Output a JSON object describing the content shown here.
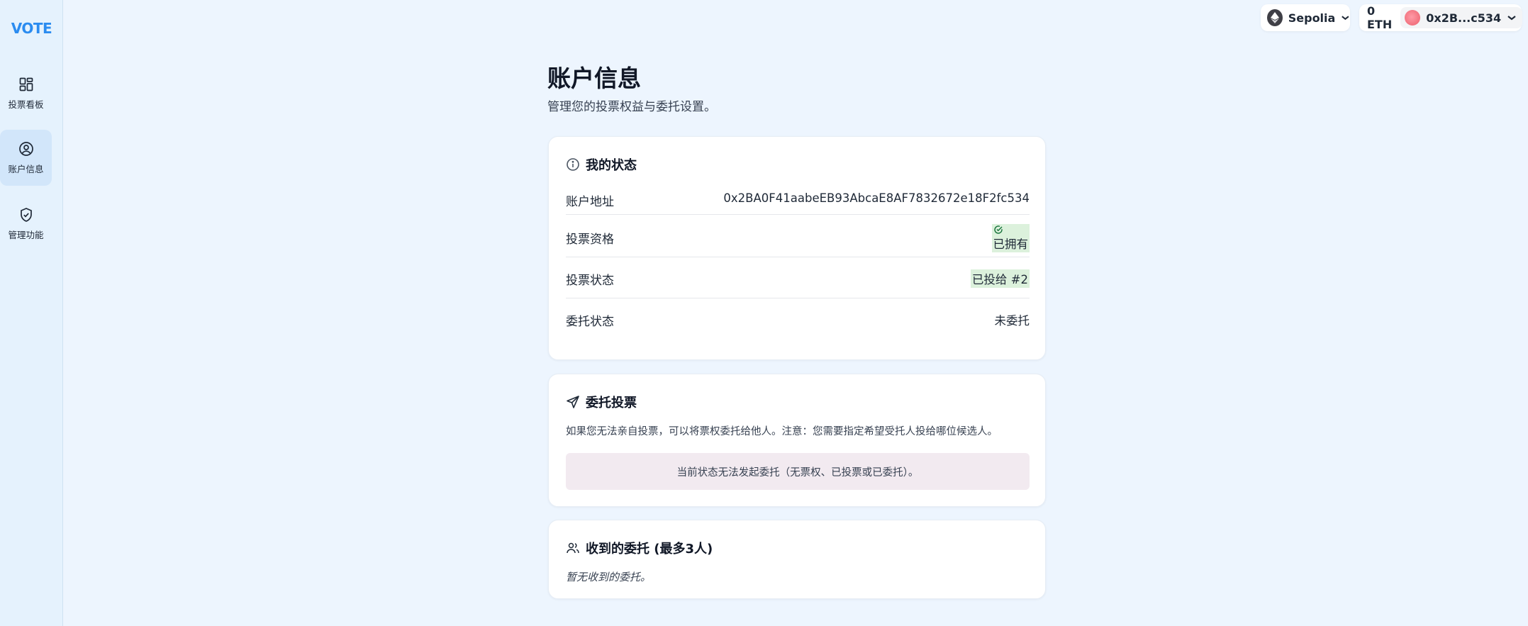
{
  "sidebar": {
    "logo": "VOTE",
    "items": [
      {
        "label": "投票看板",
        "icon": "dashboard-icon"
      },
      {
        "label": "账户信息",
        "icon": "user-circle-icon",
        "active": true
      },
      {
        "label": "管理功能",
        "icon": "shield-check-icon"
      }
    ]
  },
  "topbar": {
    "network": "Sepolia",
    "balance": "0 ETH",
    "account": "0x2B...c534"
  },
  "page": {
    "title": "账户信息",
    "subtitle": "管理您的投票权益与委托设置。"
  },
  "status_card": {
    "title": "我的状态",
    "rows": [
      {
        "label": "账户地址",
        "value": "0x2BA0F41aabeEB93AbcaE8AF7832672e18F2fc534"
      },
      {
        "label": "投票资格",
        "value": "已拥有"
      },
      {
        "label": "投票状态",
        "value": "已投给 #2"
      },
      {
        "label": "委托状态",
        "value": "未委托"
      }
    ]
  },
  "delegate_card": {
    "title": "委托投票",
    "description": "如果您无法亲自投票，可以将票权委托给他人。注意：您需要指定希望受托人投给哪位候选人。",
    "notice": "当前状态无法发起委托（无票权、已投票或已委托）。"
  },
  "received_card": {
    "title": "收到的委托 (最多3人)",
    "empty": "暂无收到的委托。"
  },
  "colors": {
    "accent": "#2b8cf0",
    "success": "#17723a",
    "success_bg": "#dcf1dc",
    "notice_bg": "#f2eaf0"
  }
}
